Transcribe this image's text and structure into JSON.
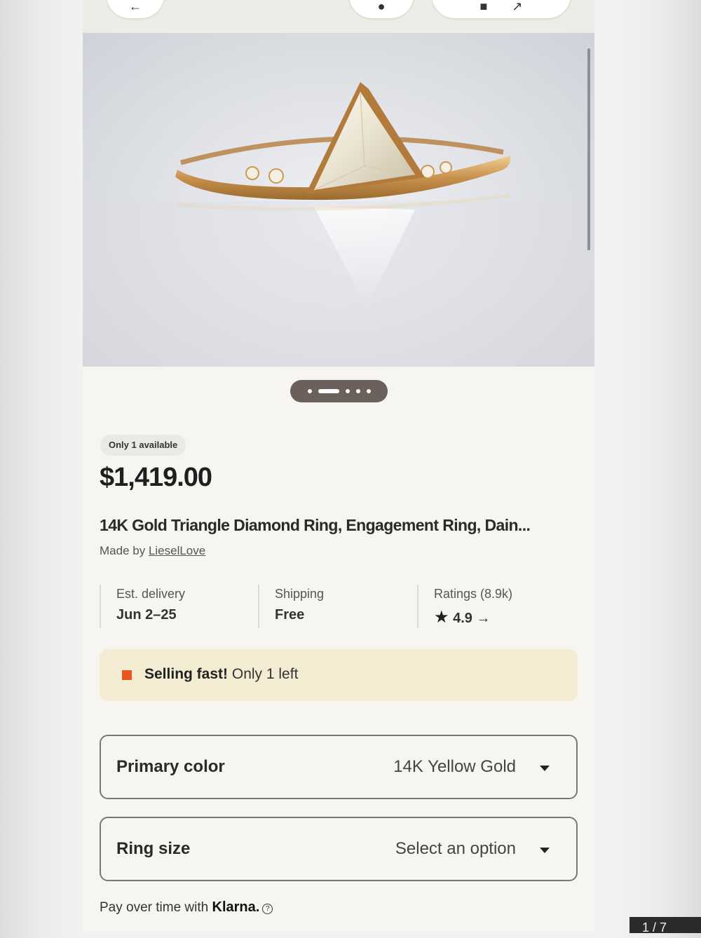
{
  "product": {
    "availability_badge": "Only 1 available",
    "price": "$1,419.00",
    "title": "14K Gold Triangle Diamond Ring, Engagement Ring, Dain...",
    "made_by_prefix": "Made by ",
    "shop_name": "LieselLove"
  },
  "gallery": {
    "total_slides": 5,
    "active_slide": 2
  },
  "info": {
    "delivery": {
      "label": "Est. delivery",
      "value": "Jun 2–25"
    },
    "shipping": {
      "label": "Shipping",
      "value": "Free"
    },
    "ratings": {
      "label": "Ratings (8.9k)",
      "value": "4.9",
      "star_icon": "★",
      "arrow_icon": "→"
    }
  },
  "alert": {
    "strong": "Selling fast!",
    "text": " Only 1 left",
    "indicator_color": "#e8561e"
  },
  "options": {
    "primary_color": {
      "label": "Primary color",
      "value": "14K Yellow Gold"
    },
    "ring_size": {
      "label": "Ring size",
      "value": "Select an option"
    }
  },
  "payment": {
    "prefix": "Pay over time with ",
    "brand": "Klarna.",
    "info_icon": "?"
  },
  "overlay": {
    "corner_text": "1 / 7"
  }
}
